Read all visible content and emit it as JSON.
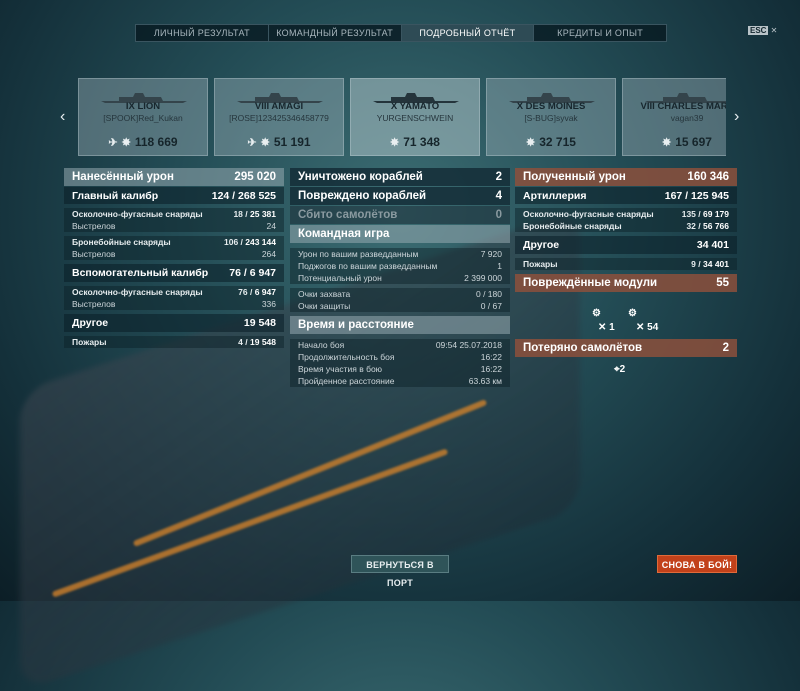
{
  "tabs": [
    "ЛИЧНЫЙ РЕЗУЛЬТАТ",
    "КОМАНДНЫЙ РЕЗУЛЬТАТ",
    "ПОДРОБНЫЙ ОТЧЁТ",
    "КРЕДИТЫ И ОПЫТ"
  ],
  "active_tab": 2,
  "esc_label": "ESC",
  "ships": [
    {
      "name": "IX LION",
      "player": "[SPOOK]Red_Kukan",
      "score": "118 669"
    },
    {
      "name": "VIII AMAGI",
      "player": "[ROSE]123425346458779",
      "score": "51 191"
    },
    {
      "name": "X YAMATO",
      "player": "YURGENSCHWEIN",
      "score": "71 348"
    },
    {
      "name": "X DES MOINES",
      "player": "[S-BUG]syvak",
      "score": "32 715"
    },
    {
      "name": "VIII CHARLES MART",
      "player": "vagan39",
      "score": "15 697"
    }
  ],
  "left": {
    "dealt_label": "Нанесённый урон",
    "dealt_val": "295 020",
    "main_label": "Главный калибр",
    "main_a": "124",
    "main_b": "268 525",
    "he_label": "Осколочно-фугасные снаряды",
    "he_a": "18",
    "he_b": "25 381",
    "shots_label": "Выстрелов",
    "he_shots": "24",
    "ap_label": "Бронебойные снаряды",
    "ap_a": "106",
    "ap_b": "243 144",
    "ap_shots": "264",
    "sec_label": "Вспомогательный калибр",
    "sec_a": "76",
    "sec_b": "6 947",
    "sec_he_a": "76",
    "sec_he_b": "6 947",
    "sec_shots": "336",
    "other_label": "Другое",
    "other_val": "19 548",
    "fire_label": "Пожары",
    "fire_a": "4",
    "fire_b": "19 548"
  },
  "mid": {
    "destroyed_label": "Уничтожено кораблей",
    "destroyed_val": "2",
    "damaged_label": "Повреждено кораблей",
    "damaged_val": "4",
    "planes_label": "Сбито самолётов",
    "planes_val": "0",
    "team_label": "Командная игра",
    "spot_dmg_label": "Урон по вашим разведданным",
    "spot_dmg_val": "7 920",
    "spot_fire_label": "Поджогов по вашим разведданным",
    "spot_fire_val": "1",
    "potential_label": "Потенциальный урон",
    "potential_val": "2 399 000",
    "cap_label": "Очки захвата",
    "cap_val": "0 / 180",
    "def_label": "Очки защиты",
    "def_val": "0 / 67",
    "time_label": "Время и расстояние",
    "start_label": "Начало боя",
    "start_val": "09:54  25.07.2018",
    "dur_label": "Продолжительность боя",
    "dur_val": "16:22",
    "part_label": "Время участия в бою",
    "part_val": "16:22",
    "dist_label": "Пройденное расстояние",
    "dist_val": "63.63 км"
  },
  "right": {
    "recv_label": "Полученный урон",
    "recv_val": "160 346",
    "art_label": "Артиллерия",
    "art_a": "167",
    "art_b": "125 945",
    "he_label": "Осколочно-фугасные снаряды",
    "he_a": "135",
    "he_b": "69 179",
    "ap_label": "Бронебойные снаряды",
    "ap_a": "32",
    "ap_b": "56 766",
    "other_label": "Другое",
    "other_val": "34 401",
    "fire_label": "Пожары",
    "fire_a": "9",
    "fire_b": "34 401",
    "mod_label": "Повреждённые модули",
    "mod_val": "55",
    "mod1": "1",
    "mod2": "54",
    "lost_planes_label": "Потеряно самолётов",
    "lost_planes_val": "2",
    "plane_count": "2"
  },
  "buttons": {
    "port": "ВЕРНУТЬСЯ В ПОРТ",
    "again": "СНОВА В БОЙ!"
  }
}
